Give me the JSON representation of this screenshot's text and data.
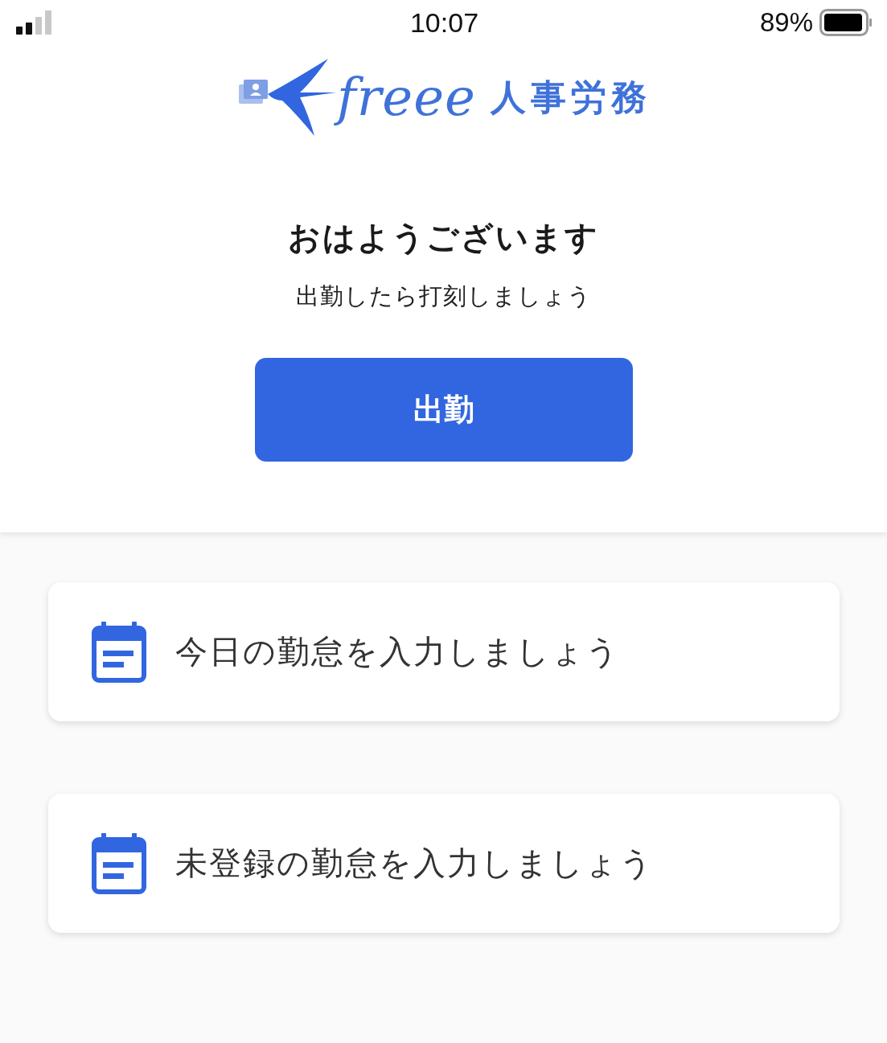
{
  "status_bar": {
    "time": "10:07",
    "battery": "89%"
  },
  "logo": {
    "wordmark": "freee",
    "product": "人事労務"
  },
  "greeting": {
    "title": "おはようございます",
    "subtitle": "出勤したら打刻しましょう"
  },
  "clock_in_button": {
    "label": "出勤"
  },
  "tasks": [
    {
      "label": "今日の勤怠を入力しましょう"
    },
    {
      "label": "未登録の勤怠を入力しましょう"
    }
  ]
}
